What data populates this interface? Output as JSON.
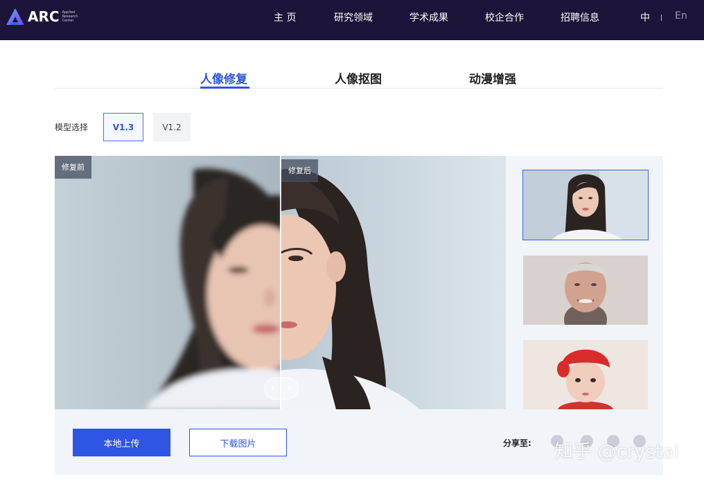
{
  "header": {
    "logo_text": "ARC",
    "logo_subtitle": "Applied Research Center",
    "nav": [
      {
        "label": "主 页"
      },
      {
        "label": "研究领域"
      },
      {
        "label": "学术成果"
      },
      {
        "label": "校企合作"
      },
      {
        "label": "招聘信息"
      }
    ],
    "lang_zh": "中",
    "lang_en": "En"
  },
  "tabs": [
    {
      "label": "人像修复",
      "active": true
    },
    {
      "label": "人像抠图",
      "active": false
    },
    {
      "label": "动漫增强",
      "active": false
    }
  ],
  "model": {
    "label": "模型选择",
    "options": [
      {
        "label": "V1.3",
        "selected": true
      },
      {
        "label": "V1.2",
        "selected": false
      }
    ]
  },
  "compare": {
    "before_label": "修复前",
    "after_label": "修复后",
    "handle_left": "‹",
    "handle_right": "›"
  },
  "thumbnails": [
    {
      "name": "young-woman",
      "selected": true
    },
    {
      "name": "older-man",
      "selected": false
    },
    {
      "name": "baby-red-hat",
      "selected": false
    }
  ],
  "actions": {
    "upload_label": "本地上传",
    "download_label": "下载图片",
    "share_label": "分享至:"
  },
  "watermark": "知乎 @crystal",
  "colors": {
    "header_bg": "#1c1439",
    "accent": "#2f55e4",
    "panel_bg": "#f1f4f8"
  }
}
